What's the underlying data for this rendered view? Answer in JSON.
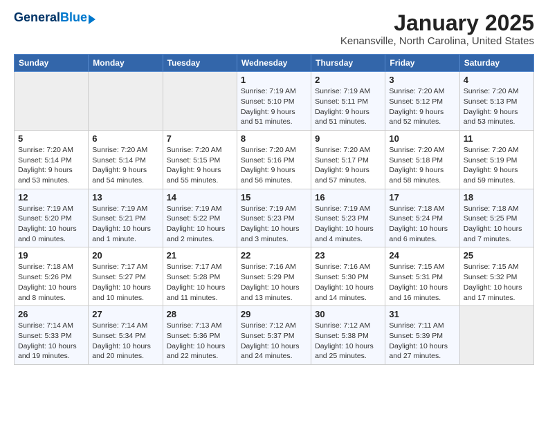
{
  "logo": {
    "line1": "General",
    "line2": "Blue"
  },
  "title": "January 2025",
  "subtitle": "Kenansville, North Carolina, United States",
  "weekdays": [
    "Sunday",
    "Monday",
    "Tuesday",
    "Wednesday",
    "Thursday",
    "Friday",
    "Saturday"
  ],
  "weeks": [
    [
      {
        "day": "",
        "empty": true
      },
      {
        "day": "",
        "empty": true
      },
      {
        "day": "",
        "empty": true
      },
      {
        "day": "1",
        "sunrise": "7:19 AM",
        "sunset": "5:10 PM",
        "daylight": "9 hours and 51 minutes."
      },
      {
        "day": "2",
        "sunrise": "7:19 AM",
        "sunset": "5:11 PM",
        "daylight": "9 hours and 51 minutes."
      },
      {
        "day": "3",
        "sunrise": "7:20 AM",
        "sunset": "5:12 PM",
        "daylight": "9 hours and 52 minutes."
      },
      {
        "day": "4",
        "sunrise": "7:20 AM",
        "sunset": "5:13 PM",
        "daylight": "9 hours and 53 minutes."
      }
    ],
    [
      {
        "day": "5",
        "sunrise": "7:20 AM",
        "sunset": "5:14 PM",
        "daylight": "9 hours and 53 minutes."
      },
      {
        "day": "6",
        "sunrise": "7:20 AM",
        "sunset": "5:14 PM",
        "daylight": "9 hours and 54 minutes."
      },
      {
        "day": "7",
        "sunrise": "7:20 AM",
        "sunset": "5:15 PM",
        "daylight": "9 hours and 55 minutes."
      },
      {
        "day": "8",
        "sunrise": "7:20 AM",
        "sunset": "5:16 PM",
        "daylight": "9 hours and 56 minutes."
      },
      {
        "day": "9",
        "sunrise": "7:20 AM",
        "sunset": "5:17 PM",
        "daylight": "9 hours and 57 minutes."
      },
      {
        "day": "10",
        "sunrise": "7:20 AM",
        "sunset": "5:18 PM",
        "daylight": "9 hours and 58 minutes."
      },
      {
        "day": "11",
        "sunrise": "7:20 AM",
        "sunset": "5:19 PM",
        "daylight": "9 hours and 59 minutes."
      }
    ],
    [
      {
        "day": "12",
        "sunrise": "7:19 AM",
        "sunset": "5:20 PM",
        "daylight": "10 hours and 0 minutes."
      },
      {
        "day": "13",
        "sunrise": "7:19 AM",
        "sunset": "5:21 PM",
        "daylight": "10 hours and 1 minute."
      },
      {
        "day": "14",
        "sunrise": "7:19 AM",
        "sunset": "5:22 PM",
        "daylight": "10 hours and 2 minutes."
      },
      {
        "day": "15",
        "sunrise": "7:19 AM",
        "sunset": "5:23 PM",
        "daylight": "10 hours and 3 minutes."
      },
      {
        "day": "16",
        "sunrise": "7:19 AM",
        "sunset": "5:23 PM",
        "daylight": "10 hours and 4 minutes."
      },
      {
        "day": "17",
        "sunrise": "7:18 AM",
        "sunset": "5:24 PM",
        "daylight": "10 hours and 6 minutes."
      },
      {
        "day": "18",
        "sunrise": "7:18 AM",
        "sunset": "5:25 PM",
        "daylight": "10 hours and 7 minutes."
      }
    ],
    [
      {
        "day": "19",
        "sunrise": "7:18 AM",
        "sunset": "5:26 PM",
        "daylight": "10 hours and 8 minutes."
      },
      {
        "day": "20",
        "sunrise": "7:17 AM",
        "sunset": "5:27 PM",
        "daylight": "10 hours and 10 minutes."
      },
      {
        "day": "21",
        "sunrise": "7:17 AM",
        "sunset": "5:28 PM",
        "daylight": "10 hours and 11 minutes."
      },
      {
        "day": "22",
        "sunrise": "7:16 AM",
        "sunset": "5:29 PM",
        "daylight": "10 hours and 13 minutes."
      },
      {
        "day": "23",
        "sunrise": "7:16 AM",
        "sunset": "5:30 PM",
        "daylight": "10 hours and 14 minutes."
      },
      {
        "day": "24",
        "sunrise": "7:15 AM",
        "sunset": "5:31 PM",
        "daylight": "10 hours and 16 minutes."
      },
      {
        "day": "25",
        "sunrise": "7:15 AM",
        "sunset": "5:32 PM",
        "daylight": "10 hours and 17 minutes."
      }
    ],
    [
      {
        "day": "26",
        "sunrise": "7:14 AM",
        "sunset": "5:33 PM",
        "daylight": "10 hours and 19 minutes."
      },
      {
        "day": "27",
        "sunrise": "7:14 AM",
        "sunset": "5:34 PM",
        "daylight": "10 hours and 20 minutes."
      },
      {
        "day": "28",
        "sunrise": "7:13 AM",
        "sunset": "5:36 PM",
        "daylight": "10 hours and 22 minutes."
      },
      {
        "day": "29",
        "sunrise": "7:12 AM",
        "sunset": "5:37 PM",
        "daylight": "10 hours and 24 minutes."
      },
      {
        "day": "30",
        "sunrise": "7:12 AM",
        "sunset": "5:38 PM",
        "daylight": "10 hours and 25 minutes."
      },
      {
        "day": "31",
        "sunrise": "7:11 AM",
        "sunset": "5:39 PM",
        "daylight": "10 hours and 27 minutes."
      },
      {
        "day": "",
        "empty": true
      }
    ]
  ],
  "labels": {
    "sunrise": "Sunrise:",
    "sunset": "Sunset:",
    "daylight": "Daylight:"
  }
}
